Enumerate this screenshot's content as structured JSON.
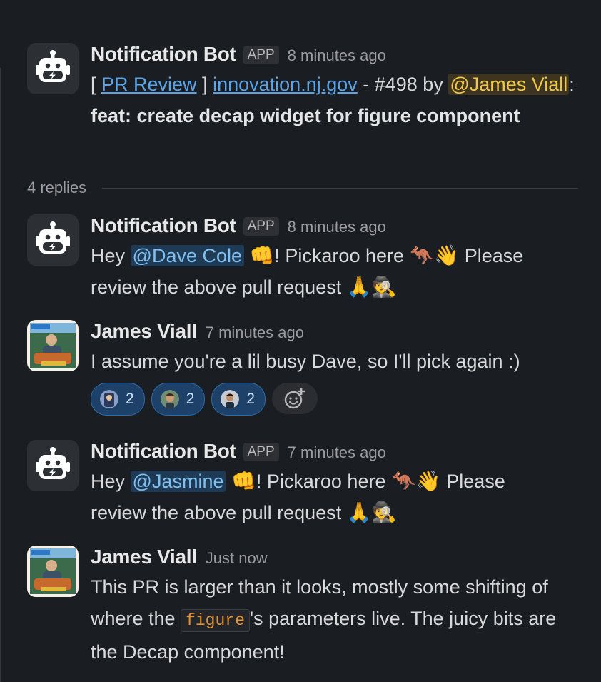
{
  "thread": {
    "parent": {
      "author": "Notification Bot",
      "badge": "APP",
      "time": "8 minutes ago",
      "open_bracket": "[ ",
      "pr_review_link": "PR Review",
      "close_bracket": " ]",
      "repo_link": "innovation.nj.gov",
      "pr_text": " - #498 by ",
      "mention": "@James Viall",
      "colon": ":",
      "title": "feat: create decap widget for figure component"
    },
    "replies_label": "4 replies",
    "messages": [
      {
        "author": "Notification Bot",
        "badge": "APP",
        "time": "8 minutes ago",
        "hey": "Hey ",
        "mention": "@Dave Cole",
        "pickaroo": "! Pickaroo here ",
        "please": " Please",
        "review": "review the above pull request "
      },
      {
        "author": "James Viall",
        "time": "7 minutes ago",
        "text": "I assume you're a lil busy Dave, so I'll pick again :)",
        "reactions": [
          {
            "count": "2"
          },
          {
            "count": "2"
          },
          {
            "count": "2"
          }
        ]
      },
      {
        "author": "Notification Bot",
        "badge": "APP",
        "time": "7 minutes ago",
        "hey": "Hey ",
        "mention": "@Jasmine",
        "pickaroo": "! Pickaroo here ",
        "please": " Please",
        "review": "review the above pull request "
      },
      {
        "author": "James Viall",
        "time": "Just now",
        "text_before": "This PR is larger than it looks, mostly some shifting of where the ",
        "code": "figure",
        "text_after": "'s parameters live. The juicy bits are the Decap component!"
      }
    ]
  },
  "emoji": {
    "fist": "👊",
    "kangaroo": "🦘",
    "wave": "👋",
    "pray": "🙏",
    "detective": "🕵"
  },
  "icons": {
    "bot_avatar": "robot-lightning-icon",
    "add_reaction": "smiley-plus-icon"
  },
  "colors": {
    "background": "#1a1d21",
    "link": "#5aa3e6",
    "mention_self": "#f2c744",
    "mention_other": "#7fc0f0",
    "reaction_bg": "#1d4168"
  }
}
